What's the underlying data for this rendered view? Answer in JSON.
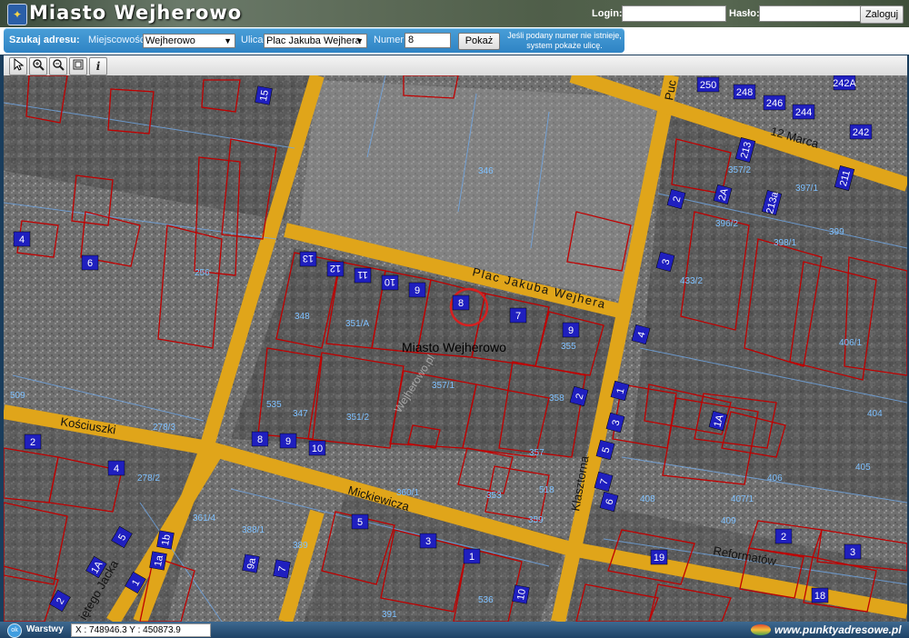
{
  "header": {
    "title": "Miasto Wejherowo",
    "login_label": "Login:",
    "password_label": "Hasło:",
    "login_value": "",
    "password_value": "",
    "login_button": "Zaloguj"
  },
  "search": {
    "label": "Szukaj adresu:",
    "municipality_label": "Miejscowość",
    "municipality_value": "Wejherowo",
    "street_label": "Ulica",
    "street_value": "Plac Jakuba Wejhera",
    "number_label": "Numer",
    "number_value": "8",
    "show_button": "Pokaż",
    "hint_line1": "Jeśli podany numer nie istnieje,",
    "hint_line2": "system pokaże ulicę."
  },
  "toolbar": {
    "tools": [
      "pointer-icon",
      "zoom-in-icon",
      "zoom-out-icon",
      "full-extent-icon",
      "info-icon"
    ],
    "info_glyph": "i"
  },
  "map": {
    "center_label": "Miasto Wejherowo",
    "watermark": "Wejherowo.pl",
    "streets": [
      "Plac Jakuba Wejhera",
      "12 Marca",
      "Kościuszki",
      "Mickiewicza",
      "Klasztorna",
      "Reformatów",
      "Puc",
      "iętego Jacka"
    ],
    "address_numbers": [
      "15",
      "250",
      "248",
      "246",
      "244",
      "242A",
      "242",
      "213",
      "211",
      "2",
      "2A",
      "213a",
      "3",
      "4",
      "1",
      "1A",
      "3",
      "5",
      "7",
      "6",
      "2",
      "13",
      "12",
      "11",
      "10",
      "9",
      "8",
      "7",
      "9",
      "2",
      "4",
      "5",
      "1A",
      "1",
      "2",
      "4",
      "6",
      "8",
      "9",
      "10",
      "1a",
      "1b",
      "5",
      "3",
      "9a",
      "7",
      "1",
      "10",
      "19",
      "18",
      "2",
      "3"
    ],
    "parcel_numbers": [
      "346",
      "256",
      "348",
      "351/A",
      "355",
      "357/1",
      "358",
      "351/2",
      "347",
      "535",
      "509",
      "278/3",
      "278/2",
      "361/4",
      "388/1",
      "389",
      "360/1",
      "357",
      "518",
      "353",
      "359",
      "391",
      "536",
      "408",
      "407/1",
      "409",
      "404",
      "405",
      "406",
      "396/2",
      "398/1",
      "399",
      "397/1",
      "406/1",
      "357/2",
      "433/2"
    ],
    "selected_number": "8"
  },
  "status": {
    "layers_icon": "ok",
    "layers_label": "Warstwy",
    "coordinates": "X : 748946.3  Y : 450873.9",
    "brand": "www.punktyadresowe.pl"
  },
  "colors": {
    "road": "#e0a51a",
    "parcel": "#c00000",
    "address_badge": "#1f1fbf",
    "selection_ring": "#d62020",
    "parcel_number": "#5fb0ff"
  }
}
